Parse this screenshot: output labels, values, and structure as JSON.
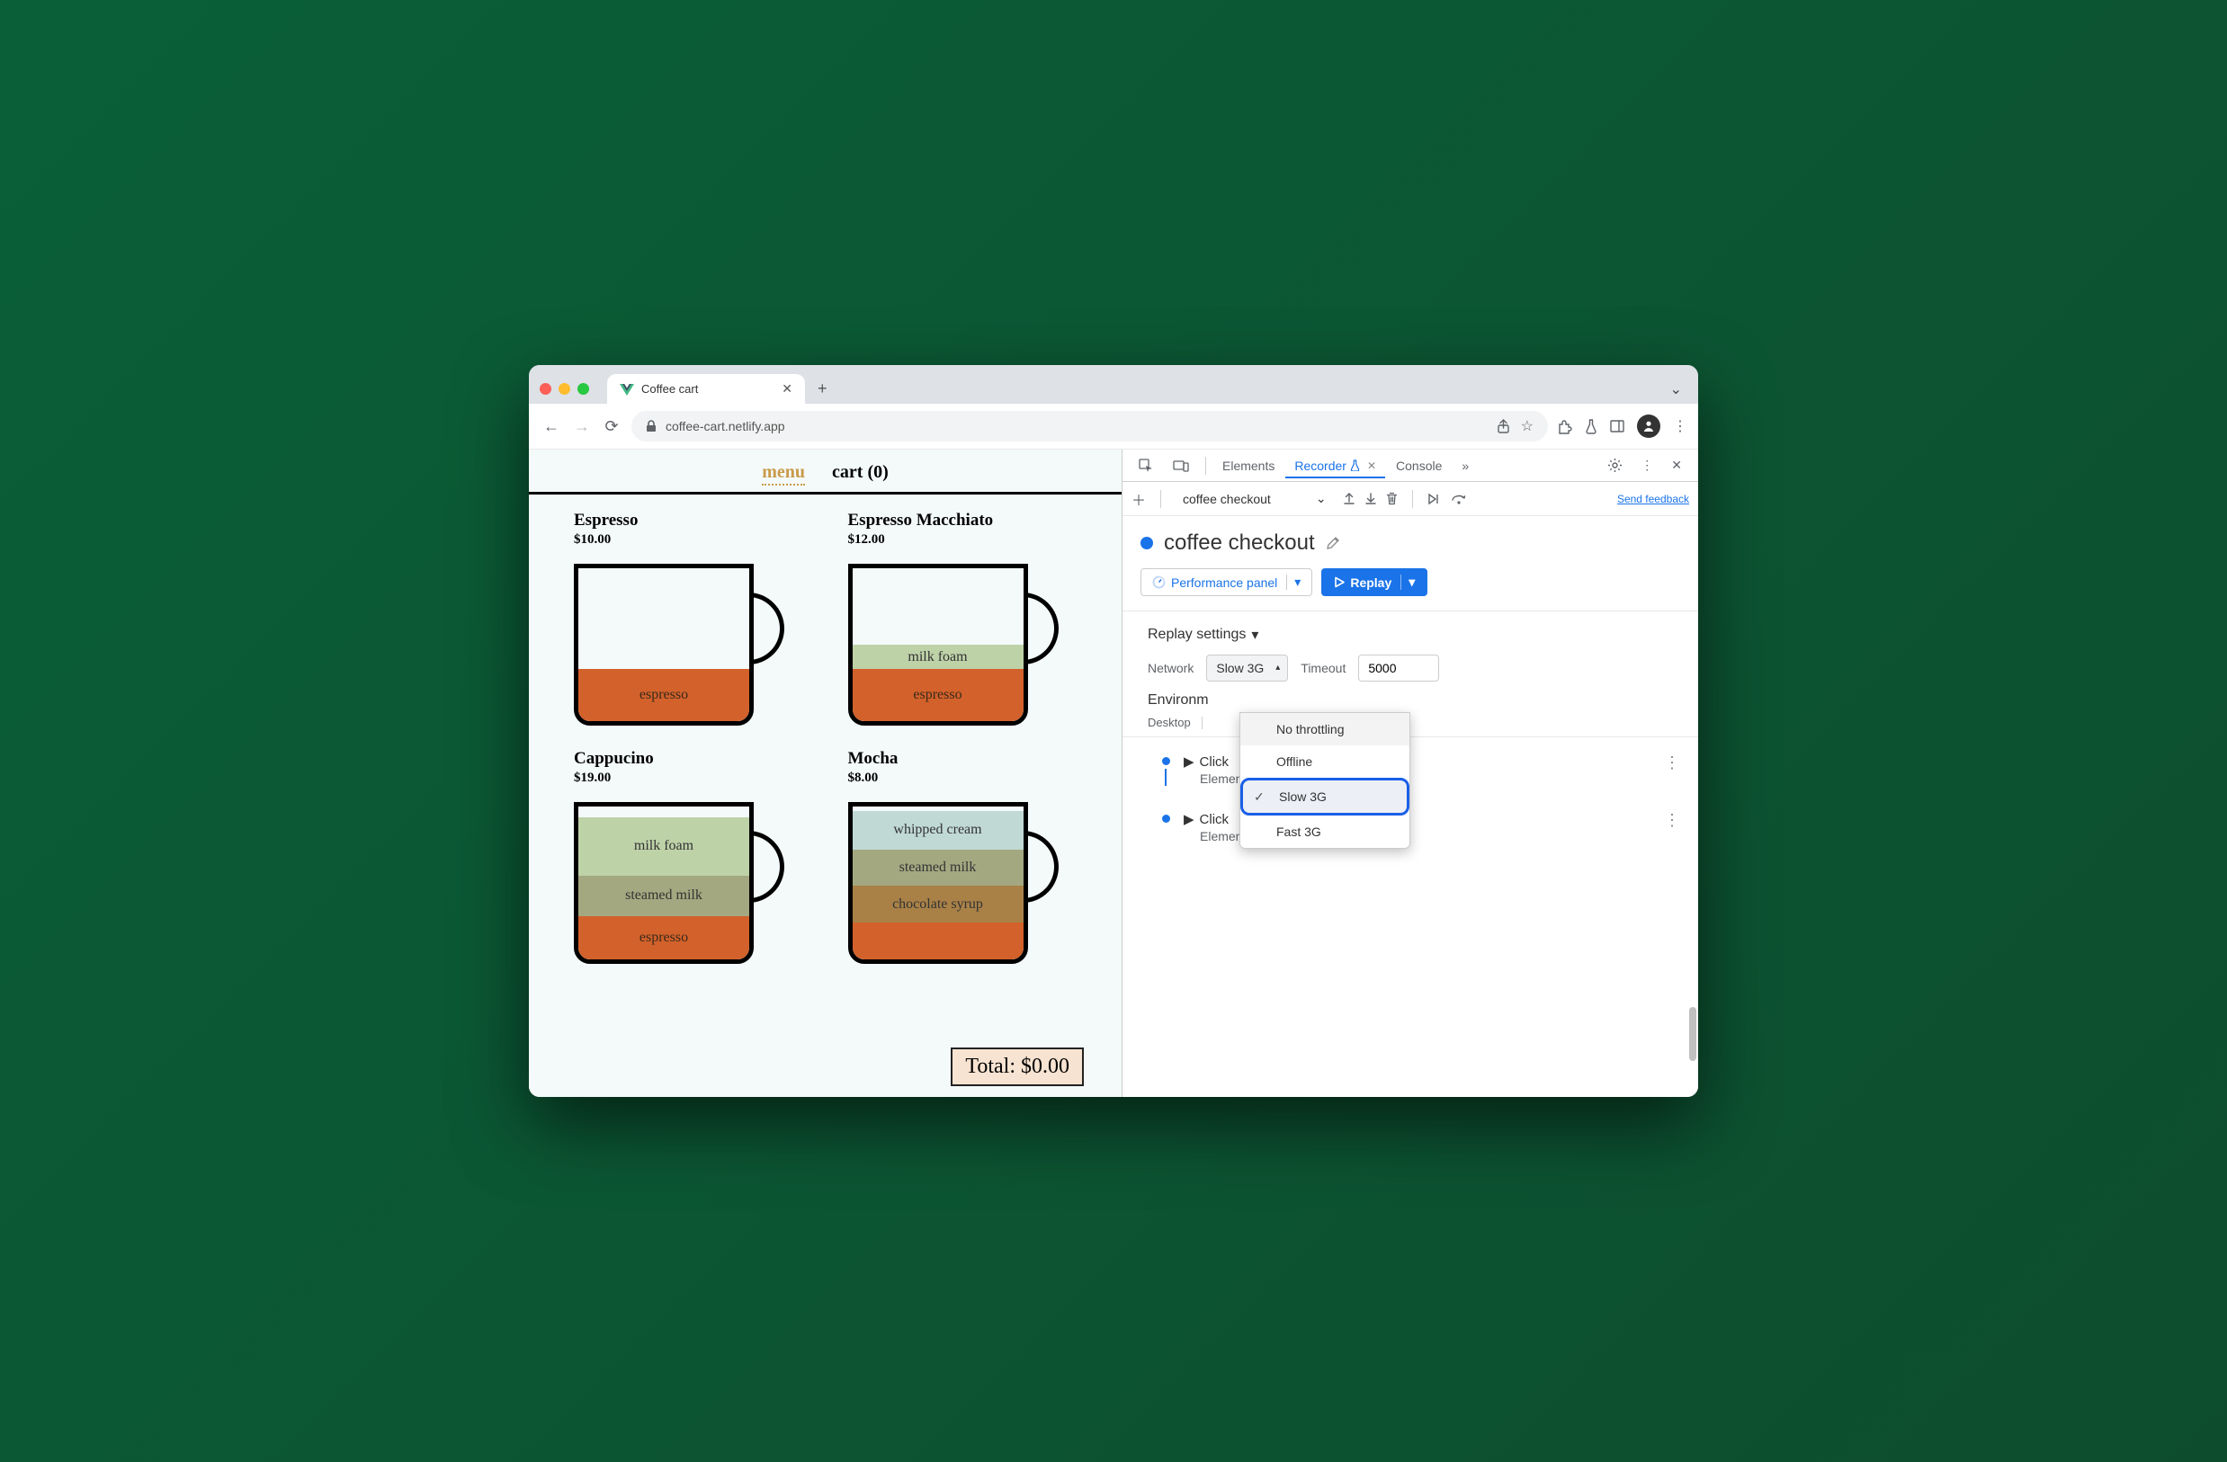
{
  "browser": {
    "tab_title": "Coffee cart",
    "url": "coffee-cart.netlify.app"
  },
  "app": {
    "nav": {
      "menu": "menu",
      "cart": "cart (0)"
    },
    "products": [
      {
        "name": "Espresso",
        "price": "$10.00"
      },
      {
        "name": "Espresso Macchiato",
        "price": "$12.00"
      },
      {
        "name": "Cappucino",
        "price": "$19.00"
      },
      {
        "name": "Mocha",
        "price": "$8.00"
      }
    ],
    "layers": {
      "espresso": "espresso",
      "milk_foam": "milk foam",
      "steamed_milk": "steamed milk",
      "chocolate_syrup": "chocolate syrup",
      "whipped_cream": "whipped cream"
    },
    "total_label": "Total: $0.00"
  },
  "devtools": {
    "tabs": {
      "elements": "Elements",
      "recorder": "Recorder",
      "console": "Console"
    },
    "recording_selector": "coffee checkout",
    "send_feedback": "Send feedback",
    "heading": "coffee checkout",
    "perf_button": "Performance panel",
    "replay_button": "Replay",
    "replay_settings_title": "Replay settings",
    "network_label": "Network",
    "network_value": "Slow 3G",
    "timeout_label": "Timeout",
    "timeout_value": "5000",
    "environment_label": "Environm",
    "environment_sub": "Desktop",
    "network_options": {
      "no_throttling": "No throttling",
      "offline": "Offline",
      "slow_3g": "Slow 3G",
      "fast_3g": "Fast 3G"
    },
    "steps": [
      {
        "title": "Click",
        "sub": "Element \"Promotion message\""
      },
      {
        "title": "Click",
        "sub": "Element \"Submit\""
      }
    ]
  }
}
